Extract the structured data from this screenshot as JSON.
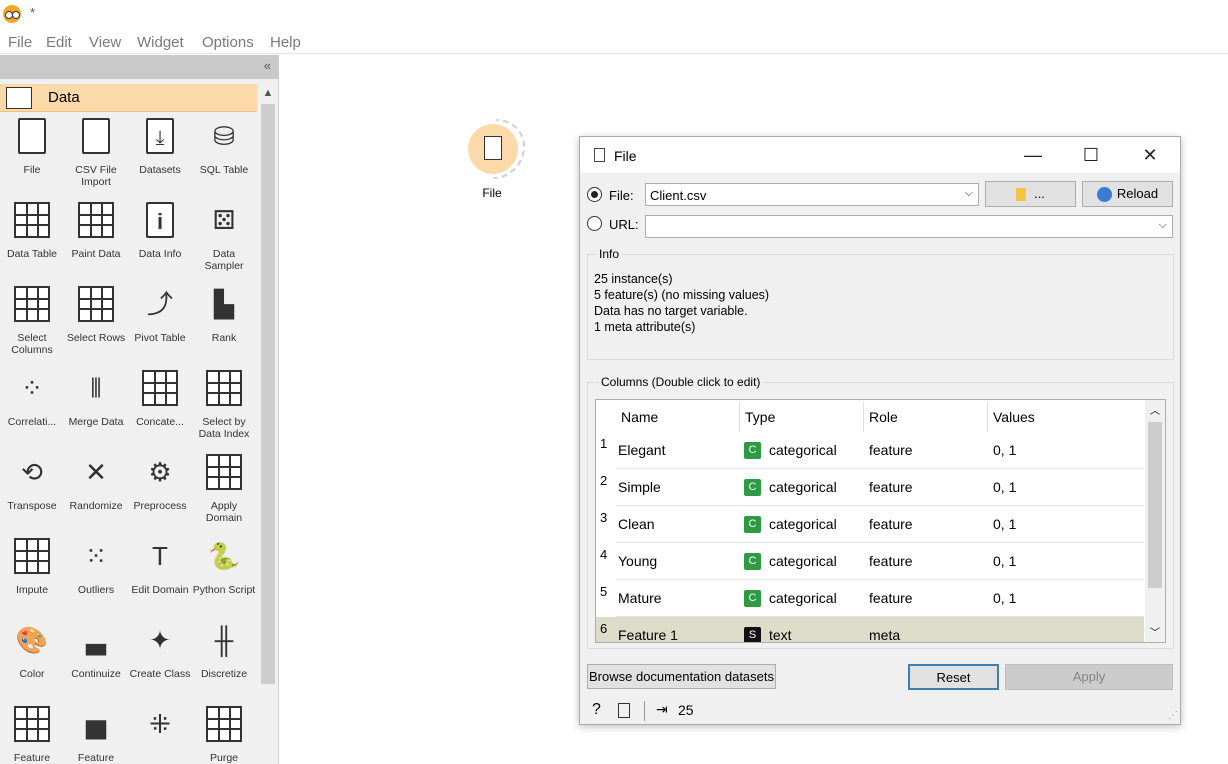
{
  "app": {
    "window_title": "*"
  },
  "menu": [
    "File",
    "Edit",
    "View",
    "Widget",
    "Options",
    "Help"
  ],
  "toolbox": {
    "category": "Data",
    "widgets": [
      {
        "label": "File",
        "icon": "file-icon"
      },
      {
        "label": "CSV File Import",
        "icon": "csv-file-icon"
      },
      {
        "label": "Datasets",
        "icon": "datasets-icon"
      },
      {
        "label": "SQL Table",
        "icon": "database-icon"
      },
      {
        "label": "Data Table",
        "icon": "data-table-icon"
      },
      {
        "label": "Paint Data",
        "icon": "paint-data-icon"
      },
      {
        "label": "Data Info",
        "icon": "info-icon"
      },
      {
        "label": "Data Sampler",
        "icon": "dice-icon"
      },
      {
        "label": "Select Columns",
        "icon": "select-columns-icon"
      },
      {
        "label": "Select Rows",
        "icon": "select-rows-icon"
      },
      {
        "label": "Pivot Table",
        "icon": "pivot-icon"
      },
      {
        "label": "Rank",
        "icon": "rank-icon"
      },
      {
        "label": "Correlati...",
        "icon": "correlations-icon"
      },
      {
        "label": "Merge Data",
        "icon": "merge-icon"
      },
      {
        "label": "Concate...",
        "icon": "concatenate-icon"
      },
      {
        "label": "Select by Data Index",
        "icon": "select-by-index-icon"
      },
      {
        "label": "Transpose",
        "icon": "transpose-icon"
      },
      {
        "label": "Randomize",
        "icon": "randomize-icon"
      },
      {
        "label": "Preprocess",
        "icon": "gears-icon"
      },
      {
        "label": "Apply Domain",
        "icon": "apply-domain-icon"
      },
      {
        "label": "Impute",
        "icon": "impute-icon"
      },
      {
        "label": "Outliers",
        "icon": "outliers-icon"
      },
      {
        "label": "Edit Domain",
        "icon": "edit-domain-icon"
      },
      {
        "label": "Python Script",
        "icon": "python-icon"
      },
      {
        "label": "Color",
        "icon": "palette-icon"
      },
      {
        "label": "Continuize",
        "icon": "continuize-icon"
      },
      {
        "label": "Create Class",
        "icon": "create-class-icon"
      },
      {
        "label": "Discretize",
        "icon": "discretize-icon"
      },
      {
        "label": "Feature",
        "icon": "feature-constructor-icon"
      },
      {
        "label": "Feature",
        "icon": "feature-statistics-icon"
      },
      {
        "label": "",
        "icon": "melt-icon"
      },
      {
        "label": "Purge",
        "icon": "purge-icon"
      }
    ]
  },
  "canvas": {
    "node_label": "File"
  },
  "dialog": {
    "title": "File",
    "file_label": "File:",
    "file_value": "Client.csv",
    "browse_label": "...",
    "reload_label": "Reload",
    "url_label": "URL:",
    "url_value": "",
    "info_title": "Info",
    "info_lines": [
      "25 instance(s)",
      "5 feature(s) (no missing values)",
      "Data has no target variable.",
      "1 meta attribute(s)"
    ],
    "columns_title": "Columns (Double click to edit)",
    "headers": [
      "Name",
      "Type",
      "Role",
      "Values"
    ],
    "rows": [
      {
        "n": "1",
        "name": "Elegant",
        "badge": "C",
        "type": "categorical",
        "role": "feature",
        "values": "0, 1"
      },
      {
        "n": "2",
        "name": "Simple",
        "badge": "C",
        "type": "categorical",
        "role": "feature",
        "values": "0, 1"
      },
      {
        "n": "3",
        "name": "Clean",
        "badge": "C",
        "type": "categorical",
        "role": "feature",
        "values": "0, 1"
      },
      {
        "n": "4",
        "name": "Young",
        "badge": "C",
        "type": "categorical",
        "role": "feature",
        "values": "0, 1"
      },
      {
        "n": "5",
        "name": "Mature",
        "badge": "C",
        "type": "categorical",
        "role": "feature",
        "values": "0, 1"
      },
      {
        "n": "6",
        "name": "Feature 1",
        "badge": "S",
        "type": "text",
        "role": "meta",
        "values": ""
      }
    ],
    "browse_docs_label": "Browse documentation datasets",
    "reset_label": "Reset",
    "apply_label": "Apply",
    "output_count": "25"
  },
  "colors": {
    "node_fill": "#fcd9a8",
    "categorical_badge": "#2e9a44",
    "text_badge": "#111111",
    "meta_row": "#dcdcc8"
  }
}
